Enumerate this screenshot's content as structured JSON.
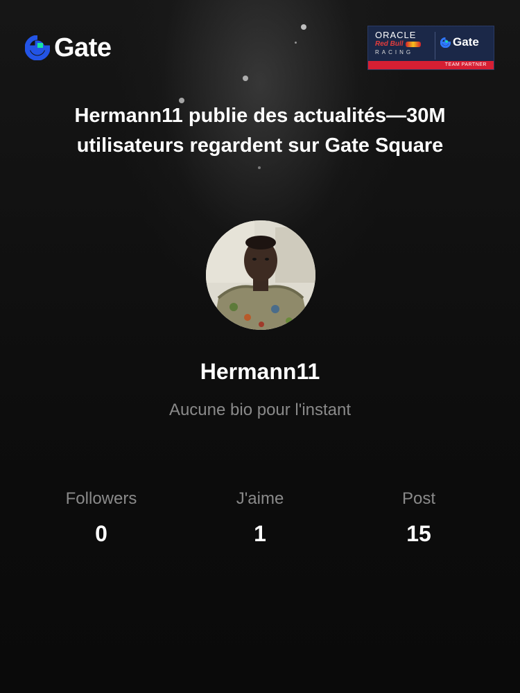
{
  "brand": {
    "logo_text": "Gate",
    "accent": "#2354e6",
    "accent_green": "#17e5a0"
  },
  "partner": {
    "oracle": "ORACLE",
    "redbull": "Red Bull",
    "racing": "RACING",
    "gate_text": "Gate",
    "strip": "TEAM PARTNER",
    "bg_color": "#1b2848",
    "strip_color": "#d71f33"
  },
  "headline": "Hermann11 publie des actualités—30M utilisateurs regardent sur Gate Square",
  "profile": {
    "username": "Hermann11",
    "bio": "Aucune bio pour l'instant"
  },
  "stats": [
    {
      "label": "Followers",
      "value": "0"
    },
    {
      "label": "J'aime",
      "value": "1"
    },
    {
      "label": "Post",
      "value": "15"
    }
  ]
}
